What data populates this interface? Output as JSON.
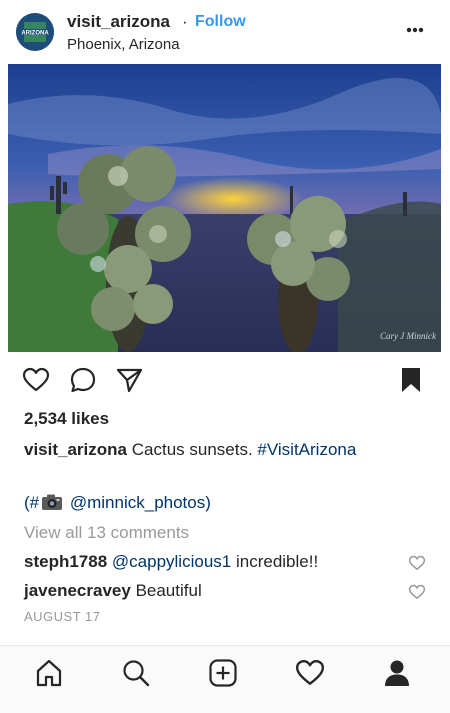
{
  "post": {
    "username": "visit_arizona",
    "separator": "·",
    "follow_label": "Follow",
    "location": "Phoenix, Arizona",
    "avatar_text": "ARIZONA",
    "photo_watermark": "Cary J Minnick"
  },
  "engagement": {
    "likes": "2,534 likes"
  },
  "caption": {
    "username": "visit_arizona",
    "text": "Cactus sunsets.",
    "hashtag": "#VisitArizona",
    "credit_prefix": "(#",
    "credit_handle": "@minnick_photos",
    "credit_suffix": ")"
  },
  "comments": {
    "view_all": "View all 13 comments",
    "items": [
      {
        "username": "steph1788",
        "mention": "@cappylicious1",
        "text": "incredible!!"
      },
      {
        "username": "javenecravey",
        "mention": "",
        "text": "Beautiful"
      }
    ]
  },
  "date": "AUGUST 17",
  "icons": {
    "like": "heart-icon",
    "comment": "comment-icon",
    "share": "send-icon",
    "save": "bookmark-icon",
    "more": "more-dots-icon",
    "home": "home-icon",
    "search": "search-icon",
    "add": "add-icon",
    "activity": "heart-icon",
    "profile": "profile-icon",
    "camera": "camera-icon"
  },
  "colors": {
    "link": "#3897f0",
    "tag": "#003569",
    "muted": "#999999",
    "text": "#262626"
  }
}
